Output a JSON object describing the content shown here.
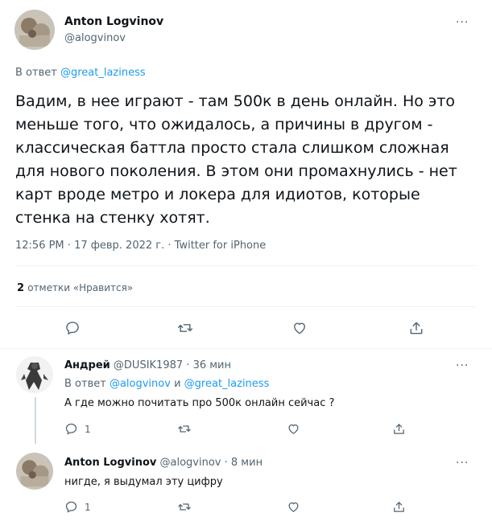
{
  "main_tweet": {
    "author_name": "Anton Logvinov",
    "author_handle": "@alogvinov",
    "reply_prefix": "В ответ",
    "reply_to": "@great_laziness",
    "text": "Вадим, в нее играют - там 500к в день онлайн. Но это меньше того, что ожидалось, а причины в другом - классическая баттла просто стала слишком сложная для нового поколения. В этом они промахнулись - нет карт вроде метро и локера для идиотов, которые стенка на стенку хотят.",
    "time": "12:56 PM",
    "date": "17 февр. 2022 г.",
    "source": "Twitter for iPhone",
    "likes_count": "2",
    "likes_label": "отметки «Нравится»",
    "separator": "·"
  },
  "replies": [
    {
      "author_name": "Андрей",
      "author_handle": "@DUSIK1987",
      "time_ago": "36 мин",
      "reply_prefix": "В ответ",
      "reply_to_1": "@alogvinov",
      "reply_and": "и",
      "reply_to_2": "@great_laziness",
      "text": "А где можно почитать про 500к онлайн сейчас ?",
      "reply_count": "1"
    },
    {
      "author_name": "Anton Logvinov",
      "author_handle": "@alogvinov",
      "time_ago": "8 мин",
      "text": "нигде, я выдумал эту цифру",
      "reply_count": "1"
    }
  ],
  "more_label": "···",
  "colors": {
    "accent": "#1d9bf0",
    "text": "#0f1419",
    "muted": "#536471",
    "divider": "#eff3f4"
  }
}
